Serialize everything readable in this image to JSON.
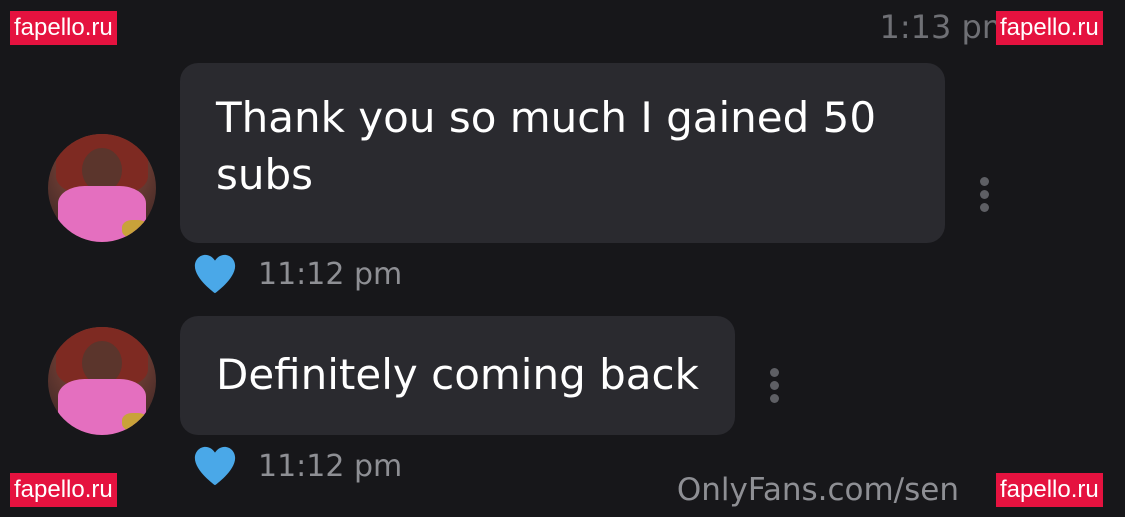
{
  "header": {
    "time": "1:13 pm"
  },
  "messages": [
    {
      "text": "Thank you so much I gained 50 subs",
      "time": "11:12 pm"
    },
    {
      "text": "Definitely coming back",
      "time": "11:12 pm"
    }
  ],
  "footer": {
    "source": "OnlyFans.com/sen"
  },
  "watermarks": [
    "fapello.ru",
    "fapello.ru",
    "fapello.ru",
    "fapello.ru"
  ],
  "colors": {
    "background": "#17171a",
    "bubble": "#2a2a2f",
    "heart": "#4aa8e8",
    "watermark": "#e5123f"
  },
  "icons": {
    "like": "heart-icon",
    "options": "more-vertical-icon"
  }
}
